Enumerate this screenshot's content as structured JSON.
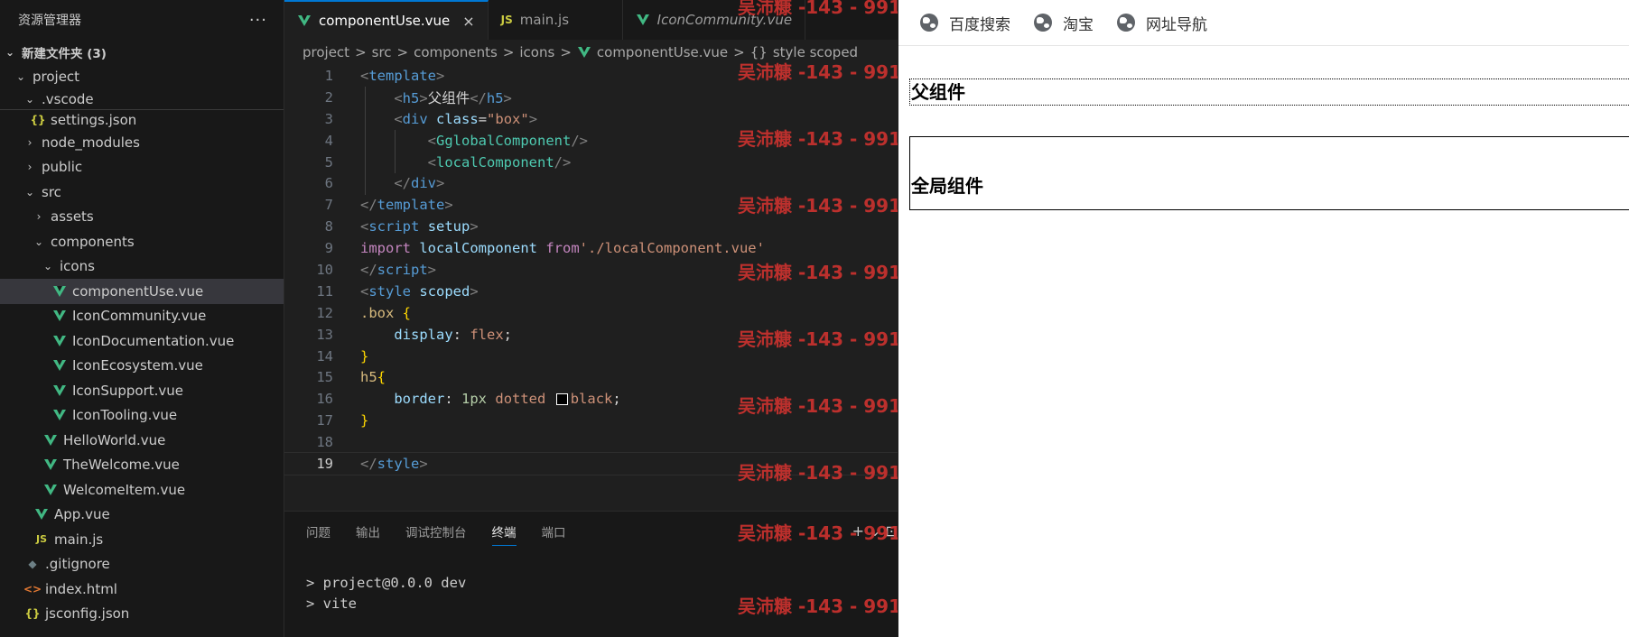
{
  "explorer": {
    "title": "资源管理器",
    "more": "···",
    "root": "新建文件夹 (3)",
    "items": [
      {
        "label": "project",
        "kind": "folder"
      },
      {
        "label": ".vscode",
        "kind": "folder"
      },
      {
        "label": "settings.json",
        "kind": "json",
        "icon": "{}"
      },
      {
        "label": "node_modules",
        "kind": "folder"
      },
      {
        "label": "public",
        "kind": "folder"
      },
      {
        "label": "src",
        "kind": "folder"
      },
      {
        "label": "assets",
        "kind": "folder"
      },
      {
        "label": "components",
        "kind": "folder"
      },
      {
        "label": "icons",
        "kind": "folder"
      },
      {
        "label": "componentUse.vue",
        "kind": "vue"
      },
      {
        "label": "IconCommunity.vue",
        "kind": "vue"
      },
      {
        "label": "IconDocumentation.vue",
        "kind": "vue"
      },
      {
        "label": "IconEcosystem.vue",
        "kind": "vue"
      },
      {
        "label": "IconSupport.vue",
        "kind": "vue"
      },
      {
        "label": "IconTooling.vue",
        "kind": "vue"
      },
      {
        "label": "HelloWorld.vue",
        "kind": "vue"
      },
      {
        "label": "TheWelcome.vue",
        "kind": "vue"
      },
      {
        "label": "WelcomeItem.vue",
        "kind": "vue"
      },
      {
        "label": "App.vue",
        "kind": "vue"
      },
      {
        "label": "main.js",
        "kind": "js",
        "icon": "JS"
      },
      {
        "label": ".gitignore",
        "kind": "git",
        "icon": "◆"
      },
      {
        "label": "index.html",
        "kind": "html",
        "icon": "<>"
      },
      {
        "label": "jsconfig.json",
        "kind": "json",
        "icon": "{}"
      }
    ]
  },
  "tabs": [
    {
      "label": "componentUse.vue",
      "close": "×"
    },
    {
      "label": "main.js",
      "icon": "JS"
    },
    {
      "label": "IconCommunity.vue"
    }
  ],
  "breadcrumb": [
    "project",
    "src",
    "components",
    "icons",
    "componentUse.vue",
    "style scoped"
  ],
  "breadcrumb_sep": ">",
  "breadcrumb_style_icon": "{}",
  "code": {
    "line_numbers": [
      "1",
      "2",
      "3",
      "4",
      "5",
      "6",
      "7",
      "8",
      "9",
      "10",
      "11",
      "12",
      "13",
      "14",
      "15",
      "16",
      "17",
      "18",
      "19"
    ],
    "l1": {
      "open": "<",
      "name": "template",
      "close": ">"
    },
    "l2": {
      "open": "<",
      "name": "h5",
      "close": ">",
      "text": "父组件",
      "eopen": "</",
      "ename": "h5",
      "eclose": ">"
    },
    "l3": {
      "open": "<",
      "name": "div",
      "attr": "class",
      "eq": "=",
      "str": "\"box\"",
      "close": ">"
    },
    "l4": {
      "open": "<",
      "name": "GglobalComponent",
      "close": "/>"
    },
    "l5": {
      "open": "<",
      "name": "localComponent",
      "close": "/>"
    },
    "l6": {
      "open": "</",
      "name": "div",
      "close": ">"
    },
    "l7": {
      "open": "</",
      "name": "template",
      "close": ">"
    },
    "l8": {
      "open": "<",
      "name": "script",
      "attr": "setup",
      "close": ">"
    },
    "l9": {
      "kw1": "import",
      "var": "localComponent",
      "kw2": "from",
      "str": "'./localComponent.vue'"
    },
    "l10": {
      "open": "</",
      "name": "script",
      "close": ">"
    },
    "l11": {
      "open": "<",
      "name": "style",
      "attr": "scoped",
      "close": ">"
    },
    "l12": {
      "sel": ".box",
      "brace": "{"
    },
    "l13": {
      "prop": "display",
      "colon": ":",
      "val": "flex",
      "semi": ";"
    },
    "l14": {
      "brace": "}"
    },
    "l15": {
      "sel": "h5",
      "brace": "{"
    },
    "l16": {
      "prop": "border",
      "colon": ":",
      "num": "1px",
      "val": "dotted",
      "val2": "black",
      "semi": ";"
    },
    "l17": {
      "brace": "}"
    },
    "l19": {
      "open": "</",
      "name": "style",
      "close": ">"
    }
  },
  "watermark": "吴沛糠 -143 - 991",
  "panel": {
    "tabs": [
      "问题",
      "输出",
      "调试控制台",
      "终端",
      "端口"
    ],
    "actions": "+ ⌄ ⊡",
    "terminal": [
      "> project@0.0.0 dev",
      "> vite"
    ]
  },
  "browser": {
    "bookmarks": [
      "百度搜索",
      "淘宝",
      "网址导航"
    ],
    "parent_heading": "父组件",
    "global_heading": "全局组件"
  },
  "colors": {
    "accent": "#0078d4",
    "vue": "#41b883",
    "watermark": "#c5312e"
  }
}
